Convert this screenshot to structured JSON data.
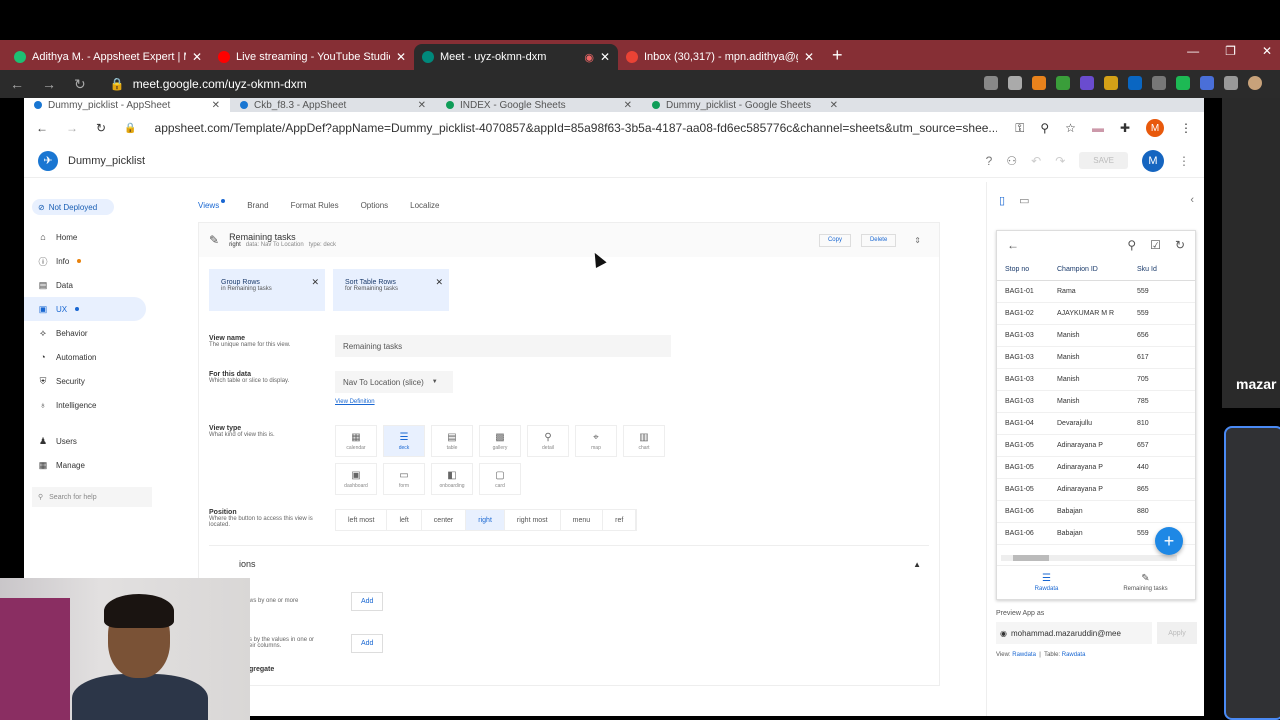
{
  "outer_tabs": [
    {
      "title": "Adithya M. - Appsheet Expert | M",
      "color": "#1dbf73"
    },
    {
      "title": "Live streaming - YouTube Studio",
      "color": "#ff0000"
    },
    {
      "title": "Meet - uyz-okmn-dxm",
      "color": "#00897b"
    },
    {
      "title": "Inbox (30,317) - mpn.adithya@g",
      "color": "#ea4335"
    }
  ],
  "outer_url": "meet.google.com/uyz-okmn-dxm",
  "inner_tabs": [
    "Dummy_picklist - AppSheet",
    "Ckb_f8.3 - AppSheet",
    "INDEX - Google Sheets",
    "Dummy_picklist - Google Sheets"
  ],
  "inner_url": "appsheet.com/Template/AppDef?appName=Dummy_picklist-4070857&appId=85a98f63-3b5a-4187-aa08-fd6ec585776c&channel=sheets&utm_source=shee...",
  "app": {
    "name": "Dummy_picklist",
    "save_label": "SAVE",
    "user_initial": "M",
    "browser_user_initial": "M"
  },
  "sidebar": {
    "status": "Not Deployed",
    "items": [
      {
        "label": "Home",
        "icon": "home-icon",
        "glyph": "⌂"
      },
      {
        "label": "Info",
        "icon": "info-icon",
        "glyph": "ⓘ"
      },
      {
        "label": "Data",
        "icon": "data-icon",
        "glyph": "▤"
      },
      {
        "label": "UX",
        "icon": "ux-icon",
        "glyph": "▣"
      },
      {
        "label": "Behavior",
        "icon": "behavior-icon",
        "glyph": "⟡"
      },
      {
        "label": "Automation",
        "icon": "automation-icon",
        "glyph": "◔"
      },
      {
        "label": "Security",
        "icon": "security-icon",
        "glyph": "⛨"
      },
      {
        "label": "Intelligence",
        "icon": "intelligence-icon",
        "glyph": "♁"
      }
    ],
    "bottom_items": [
      {
        "label": "Users",
        "icon": "users-icon",
        "glyph": "♟"
      },
      {
        "label": "Manage",
        "icon": "manage-icon",
        "glyph": "▦"
      }
    ],
    "search_placeholder": "Search for help"
  },
  "editor": {
    "tabs": [
      "Views",
      "Brand",
      "Format Rules",
      "Options",
      "Localize"
    ],
    "view_title": "Remaining tasks",
    "view_sub_position": "right",
    "view_sub_data": "data: Nav To Location",
    "view_sub_type": "type: deck",
    "copy_label": "Copy",
    "delete_label": "Delete",
    "chips": [
      {
        "title": "Group Rows",
        "sub": "in Remaining tasks"
      },
      {
        "title": "Sort Table Rows",
        "sub": "for Remaining tasks"
      }
    ],
    "view_name_label": "View name",
    "view_name_desc": "The unique name for this view.",
    "view_name_value": "Remaining tasks",
    "for_data_label": "For this data",
    "for_data_desc": "Which table or slice to display.",
    "for_data_value": "Nav To Location (slice)",
    "view_definition_link": "View Definition",
    "view_type_label": "View type",
    "view_type_desc": "What kind of view this is.",
    "view_types": [
      {
        "label": "calendar",
        "glyph": "▦"
      },
      {
        "label": "deck",
        "glyph": "☰"
      },
      {
        "label": "table",
        "glyph": "▤"
      },
      {
        "label": "gallery",
        "glyph": "▩"
      },
      {
        "label": "detail",
        "glyph": "⚲"
      },
      {
        "label": "map",
        "glyph": "⌖"
      },
      {
        "label": "chart",
        "glyph": "▥"
      },
      {
        "label": "dashboard",
        "glyph": "▣"
      },
      {
        "label": "form",
        "glyph": "▭"
      },
      {
        "label": "onboarding",
        "glyph": "◧"
      },
      {
        "label": "card",
        "glyph": "▢"
      }
    ],
    "position_label": "Position",
    "position_desc": "Where the button to access this view is located.",
    "positions": [
      "left most",
      "left",
      "center",
      "right",
      "right most",
      "menu",
      "ref"
    ],
    "options_title": "ions",
    "opt1_desc": "ws by one or more",
    "opt2_desc_a": "s by the values in one or",
    "opt2_desc_b": "eir columns.",
    "opt3_label": "gregate",
    "add_label": "Add"
  },
  "preview": {
    "columns": [
      "Stop no",
      "Champion ID",
      "Sku Id"
    ],
    "rows": [
      [
        "BAG1-01",
        "Rama",
        "559"
      ],
      [
        "BAG1-02",
        "AJAYKUMAR M R",
        "559"
      ],
      [
        "BAG1-03",
        "Manish",
        "656"
      ],
      [
        "BAG1-03",
        "Manish",
        "617"
      ],
      [
        "BAG1-03",
        "Manish",
        "705"
      ],
      [
        "BAG1-03",
        "Manish",
        "785"
      ],
      [
        "BAG1-04",
        "Devarajullu",
        "810"
      ],
      [
        "BAG1-05",
        "Adinarayana P",
        "657"
      ],
      [
        "BAG1-05",
        "Adinarayana P",
        "440"
      ],
      [
        "BAG1-05",
        "Adinarayana P",
        "865"
      ],
      [
        "BAG1-06",
        "Babajan",
        "880"
      ],
      [
        "BAG1-06",
        "Babajan",
        "559"
      ]
    ],
    "nav": [
      "Rawdata",
      "Remaining tasks"
    ],
    "preview_as_label": "Preview App as",
    "email": "mohammad.mazaruddin@mee",
    "apply_label": "Apply",
    "view_label": "View:",
    "view_value": "Rawdata",
    "table_label": "Table:",
    "table_value": "Rawdata"
  },
  "meet": {
    "participant_name": "mazar"
  }
}
